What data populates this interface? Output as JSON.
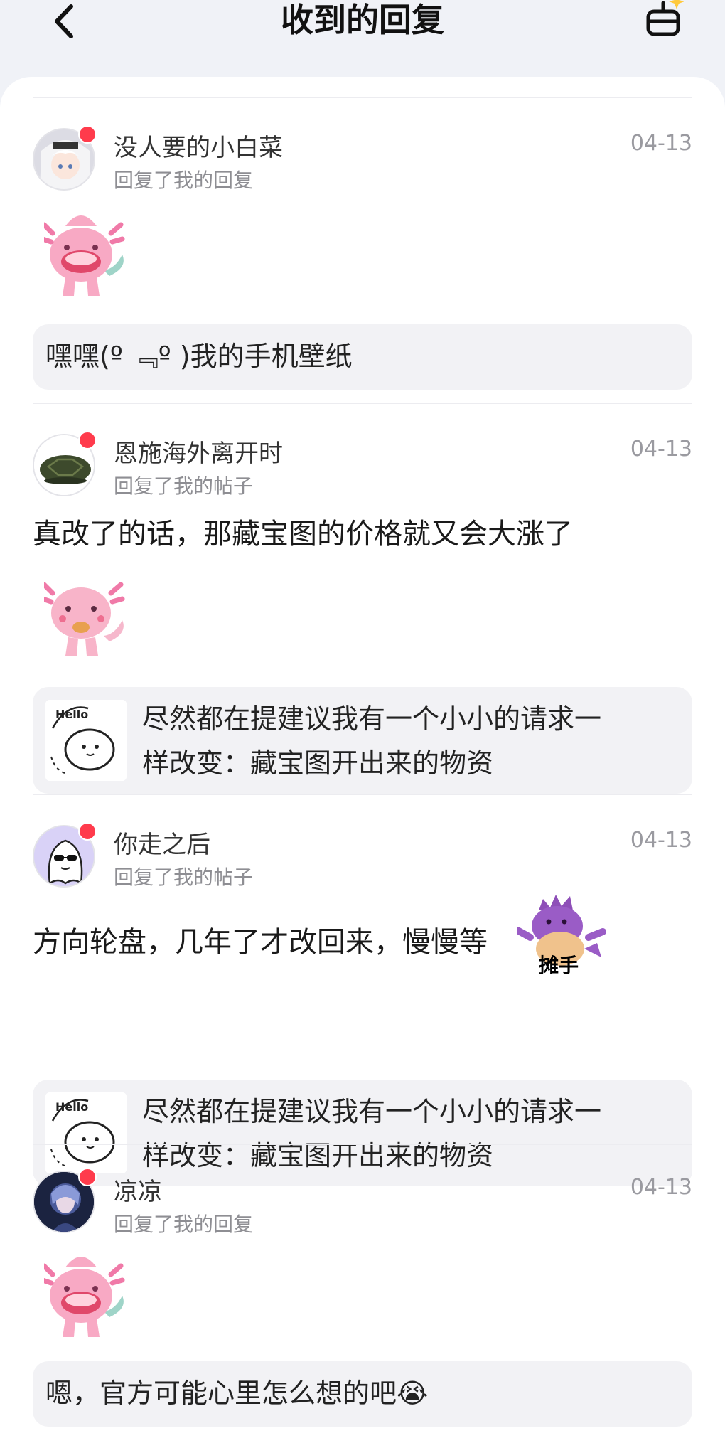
{
  "header": {
    "title": "收到的回复"
  },
  "notifications": [
    {
      "username": "没人要的小白菜",
      "action": "回复了我的回复",
      "date": "04-13",
      "quote": "嘿嘿(º ﹃º )我的手机壁纸"
    },
    {
      "username": "恩施海外离开时",
      "action": "回复了我的帖子",
      "date": "04-13",
      "reply": "真改了的话，那藏宝图的价格就又会大涨了",
      "quote_line1": "尽然都在提建议我有一个小小的请求一",
      "quote_line2": "样改变：藏宝图开出来的物资"
    },
    {
      "username": "你走之后",
      "action": "回复了我的帖子",
      "date": "04-13",
      "reply": "方向轮盘，几年了才改回来，慢慢等",
      "emoji_caption": "摊手",
      "quote_line1": "尽然都在提建议我有一个小小的请求一",
      "quote_line2": "样改变：藏宝图开出来的物资"
    },
    {
      "username": "凉凉",
      "action": "回复了我的回复",
      "date": "04-13",
      "quote": "嗯，官方可能心里怎么想的吧😭"
    }
  ],
  "thumb_text": "Hello",
  "colors": {
    "unread_dot": "#ff3b4c",
    "background": "#f0f2f7",
    "panel": "#ffffff",
    "quote_bg": "#f2f2f5"
  }
}
